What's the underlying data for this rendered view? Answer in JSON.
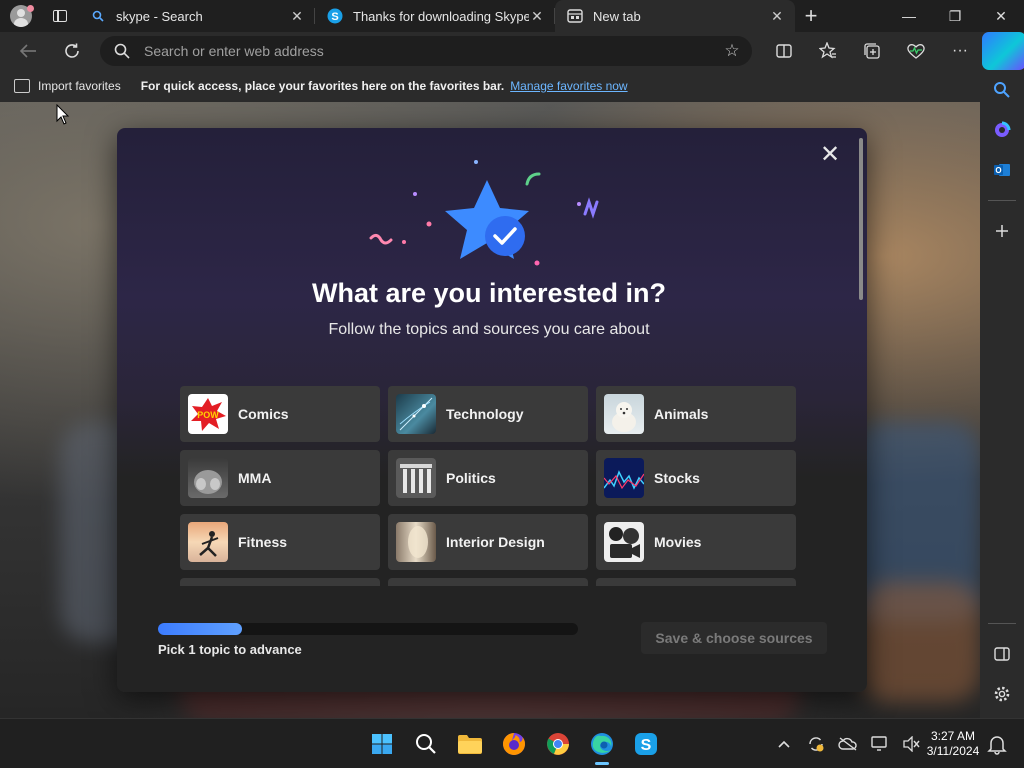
{
  "tabs": [
    {
      "title": "skype - Search",
      "icon": "search-icon"
    },
    {
      "title": "Thanks for downloading Skype",
      "icon": "skype-icon"
    },
    {
      "title": "New tab",
      "icon": "new-tab-page-icon"
    }
  ],
  "tab_close": "✕",
  "window_controls": {
    "minimize": "—",
    "restore": "❐",
    "close": "✕"
  },
  "address": {
    "placeholder": "Search or enter web address"
  },
  "favorites_bar": {
    "import": "Import favorites",
    "message": "For quick access, place your favorites here on the favorites bar.",
    "link": "Manage favorites now"
  },
  "modal": {
    "close_glyph": "✕",
    "title": "What are you interested in?",
    "subtitle": "Follow the topics and sources you care about",
    "topics": [
      {
        "label": "Comics"
      },
      {
        "label": "Technology"
      },
      {
        "label": "Animals"
      },
      {
        "label": "MMA"
      },
      {
        "label": "Politics"
      },
      {
        "label": "Stocks"
      },
      {
        "label": "Fitness"
      },
      {
        "label": "Interior Design"
      },
      {
        "label": "Movies"
      }
    ],
    "progress_fraction": 0.2,
    "progress_label": "Pick 1 topic to advance",
    "save_button": "Save & choose sources"
  },
  "taskbar": {
    "time": "3:27 AM",
    "date": "3/11/2024"
  },
  "colors": {
    "accent": "#3c7cff",
    "link": "#6cb6ff",
    "modal_bg": "#232323"
  }
}
